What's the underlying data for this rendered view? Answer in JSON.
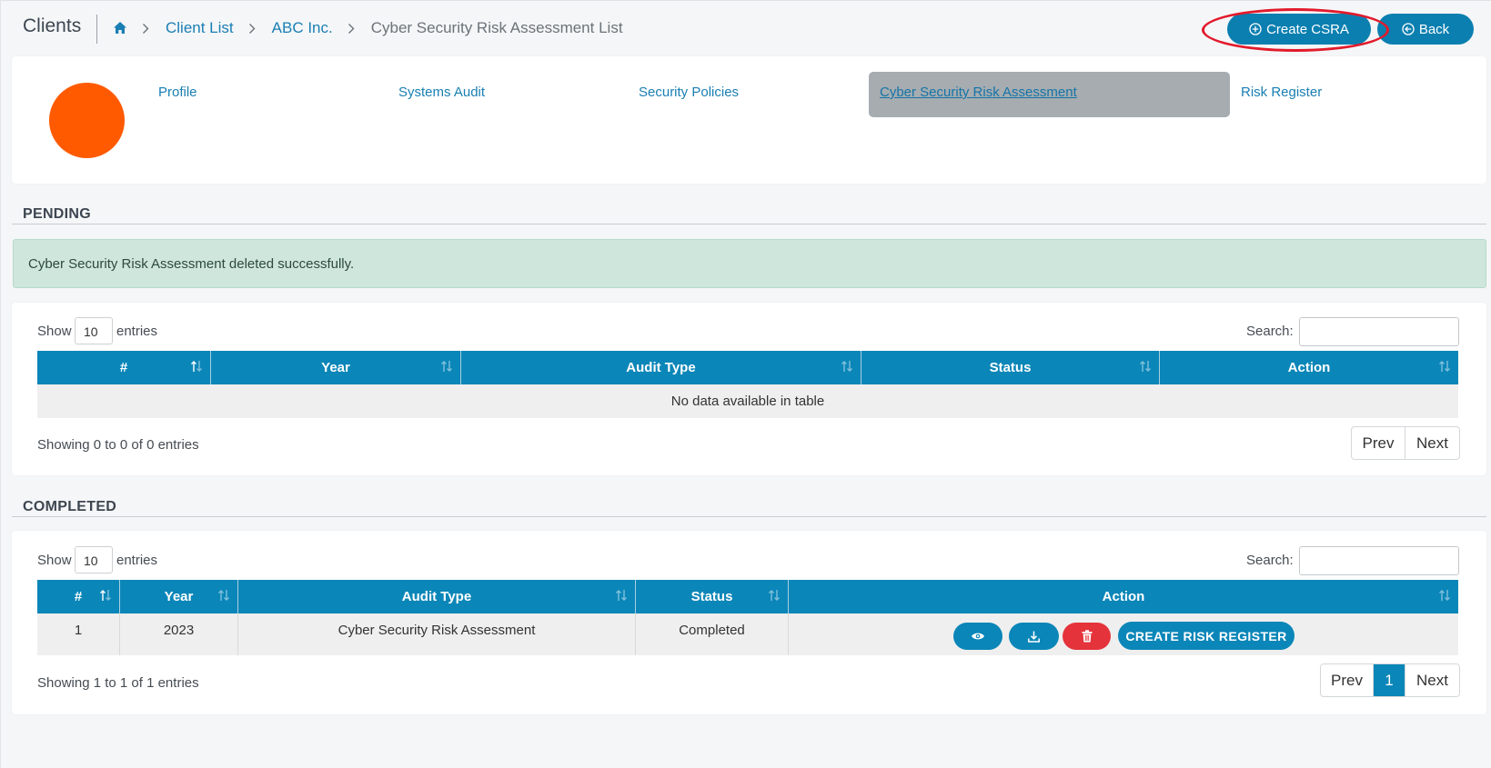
{
  "header": {
    "title": "Clients",
    "breadcrumb": [
      "Client List",
      "ABC Inc.",
      "Cyber Security Risk Assessment List"
    ],
    "create_label": "Create CSRA",
    "back_label": "Back"
  },
  "profile_tabs": [
    {
      "label": "Profile"
    },
    {
      "label": "Systems Audit"
    },
    {
      "label": "Security Policies"
    },
    {
      "label": "Cyber Security Risk Assessment",
      "active": true
    },
    {
      "label": "Risk Register"
    }
  ],
  "alert": "Cyber Security Risk Assessment deleted successfully.",
  "pending": {
    "heading": "PENDING",
    "show_label": "Show",
    "page_length": "10",
    "entries_label": "entries",
    "search_label": "Search:",
    "columns": [
      "#",
      "Year",
      "Audit Type",
      "Status",
      "Action"
    ],
    "empty_text": "No data available in table",
    "info": "Showing 0 to 0 of 0 entries",
    "pager": [
      "Prev",
      "Next"
    ]
  },
  "completed": {
    "heading": "COMPLETED",
    "show_label": "Show",
    "page_length": "10",
    "entries_label": "entries",
    "search_label": "Search:",
    "columns": [
      "#",
      "Year",
      "Audit Type",
      "Status",
      "Action"
    ],
    "rows": [
      {
        "num": "1",
        "year": "2023",
        "audit_type": "Cyber Security Risk Assessment",
        "status": "Completed",
        "actions": [
          "eye-icon",
          "download-icon",
          "trash-icon"
        ],
        "create_label": "CREATE RISK REGISTER"
      }
    ],
    "info": "Showing 1 to 1 of 1 entries",
    "pager": [
      "Prev",
      "1",
      "Next"
    ]
  },
  "colors": {
    "primary": "#0b86b8",
    "avatar": "#ff5a00",
    "danger": "#e5333b",
    "alert_bg": "#cfe6dc",
    "highlight": "#e21a2b"
  }
}
